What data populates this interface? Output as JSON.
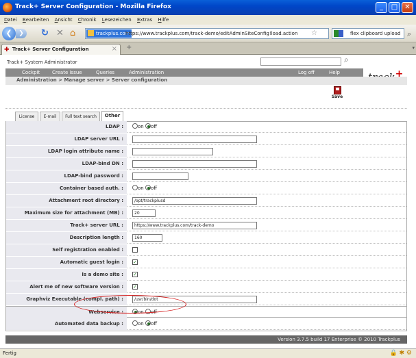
{
  "window": {
    "title": "Track+ Server Configuration - Mozilla Firefox"
  },
  "menubar": [
    "Datei",
    "Bearbeiten",
    "Ansicht",
    "Chronik",
    "Lesezeichen",
    "Extras",
    "Hilfe"
  ],
  "navbar": {
    "site_badge": "trackplus.com",
    "url": "https://www.trackplus.com/track-demo/editAdminSiteConfig!load.action",
    "search_text": "flex clipboard upload"
  },
  "browser_tab": {
    "label": "Track+ Server Configuration"
  },
  "app": {
    "user": "Track+ System Administrator",
    "logo": "track",
    "logo_plus": "+",
    "nav": [
      "Cockpit",
      "Create Issue",
      "Queries",
      "Administration"
    ],
    "nav_right": [
      "Log off",
      "Help"
    ],
    "breadcrumb": "Administration  >  Manage server  >  Server configuration",
    "save_label": "Save"
  },
  "form_tabs": [
    "License",
    "E-mail",
    "Full text search",
    "Other"
  ],
  "form": {
    "on_label": "on",
    "off_label": "off",
    "rows": [
      {
        "label": "LDAP :",
        "type": "radio",
        "value": "off"
      },
      {
        "label": "LDAP server URL :",
        "type": "text",
        "value": ""
      },
      {
        "label": "LDAP login attribute name :",
        "type": "text",
        "value": ""
      },
      {
        "label": "LDAP-bind DN :",
        "type": "text",
        "value": ""
      },
      {
        "label": "LDAP-bind password :",
        "type": "text",
        "value": ""
      },
      {
        "label": "Container based auth. :",
        "type": "radio",
        "value": "off"
      },
      {
        "label": "Attachment root directory :",
        "type": "text",
        "value": "/opt/trackplusd"
      },
      {
        "label": "Maximum size for attachment (MB) :",
        "type": "text",
        "value": "20"
      },
      {
        "label": "Track+ server URL :",
        "type": "text",
        "value": "https://www.trackplus.com/track-demo"
      },
      {
        "label": "Description length :",
        "type": "text",
        "value": "160"
      },
      {
        "label": "Self registration enabled :",
        "type": "checkbox",
        "value": false
      },
      {
        "label": "Automatic guest login :",
        "type": "checkbox",
        "value": true
      },
      {
        "label": "Is a demo site :",
        "type": "checkbox",
        "value": true
      },
      {
        "label": "Alert me of new software version :",
        "type": "checkbox",
        "value": true
      },
      {
        "label": "Graphviz Executable (compl. path) :",
        "type": "text",
        "value": "/usr/bin/dot"
      },
      {
        "label": "Webservice :",
        "type": "radio",
        "value": "on"
      },
      {
        "label": "Automated data backup :",
        "type": "radio",
        "value": "off"
      }
    ]
  },
  "footer": {
    "version": "Version 3.7.5 build 17 Enterprise  © 2010 Trackplus"
  },
  "statusbar": {
    "text": "Fertig"
  },
  "colors": {
    "titlebar": "#0046c8",
    "app_nav": "#8a8a8a",
    "label_bg": "#e9e9ef",
    "highlight": "#d42020"
  }
}
